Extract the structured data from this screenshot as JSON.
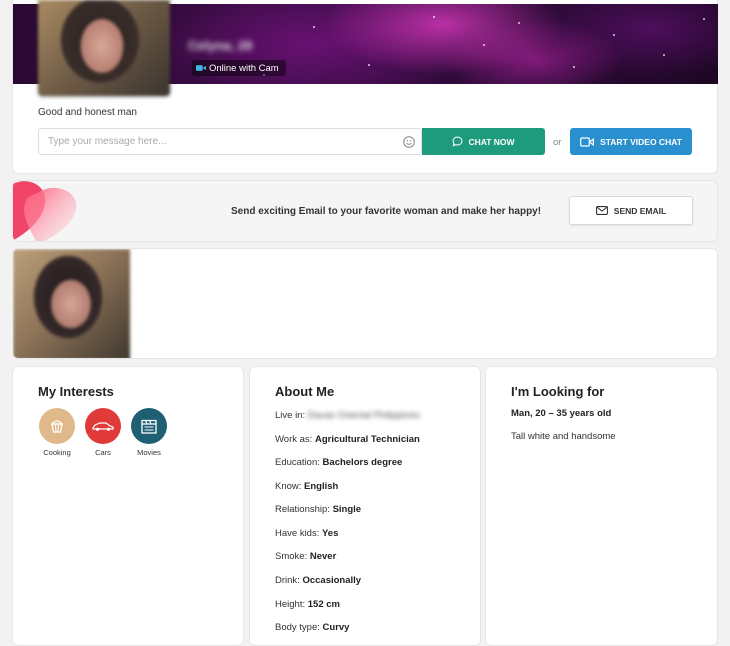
{
  "profile": {
    "name": "Celyna, 28",
    "status": "Online with Cam",
    "headline": "Good and honest man"
  },
  "message": {
    "placeholder": "Type your message here...",
    "chat_label": "CHAT NOW",
    "or_label": "or",
    "video_label": "START VIDEO CHAT"
  },
  "email": {
    "text": "Send exciting Email to your favorite woman and make her happy!",
    "button_label": "SEND EMAIL"
  },
  "interests": {
    "title": "My Interests",
    "items": [
      {
        "label": "Cooking",
        "icon": "cupcake-icon",
        "color": "#e0b98a"
      },
      {
        "label": "Cars",
        "icon": "car-icon",
        "color": "#e03a3a"
      },
      {
        "label": "Movies",
        "icon": "clapperboard-icon",
        "color": "#1f5f74"
      }
    ]
  },
  "about": {
    "title": "About Me",
    "rows": [
      {
        "label": "Live in:",
        "value": "Davao Oriental Philippines"
      },
      {
        "label": "Work as:",
        "value": "Agricultural Technician"
      },
      {
        "label": "Education:",
        "value": "Bachelors degree"
      },
      {
        "label": "Know:",
        "value": "English"
      },
      {
        "label": "Relationship:",
        "value": "Single"
      },
      {
        "label": "Have kids:",
        "value": "Yes"
      },
      {
        "label": "Smoke:",
        "value": "Never"
      },
      {
        "label": "Drink:",
        "value": "Occasionally"
      },
      {
        "label": "Height:",
        "value": "152 cm"
      },
      {
        "label": "Body type:",
        "value": "Curvy"
      }
    ]
  },
  "looking": {
    "title": "I'm Looking for",
    "age_range": "Man, 20 – 35 years old",
    "description": "Tall white and handsome"
  },
  "colors": {
    "chat_button": "#1e9b7c",
    "video_button": "#2a8fcf"
  }
}
